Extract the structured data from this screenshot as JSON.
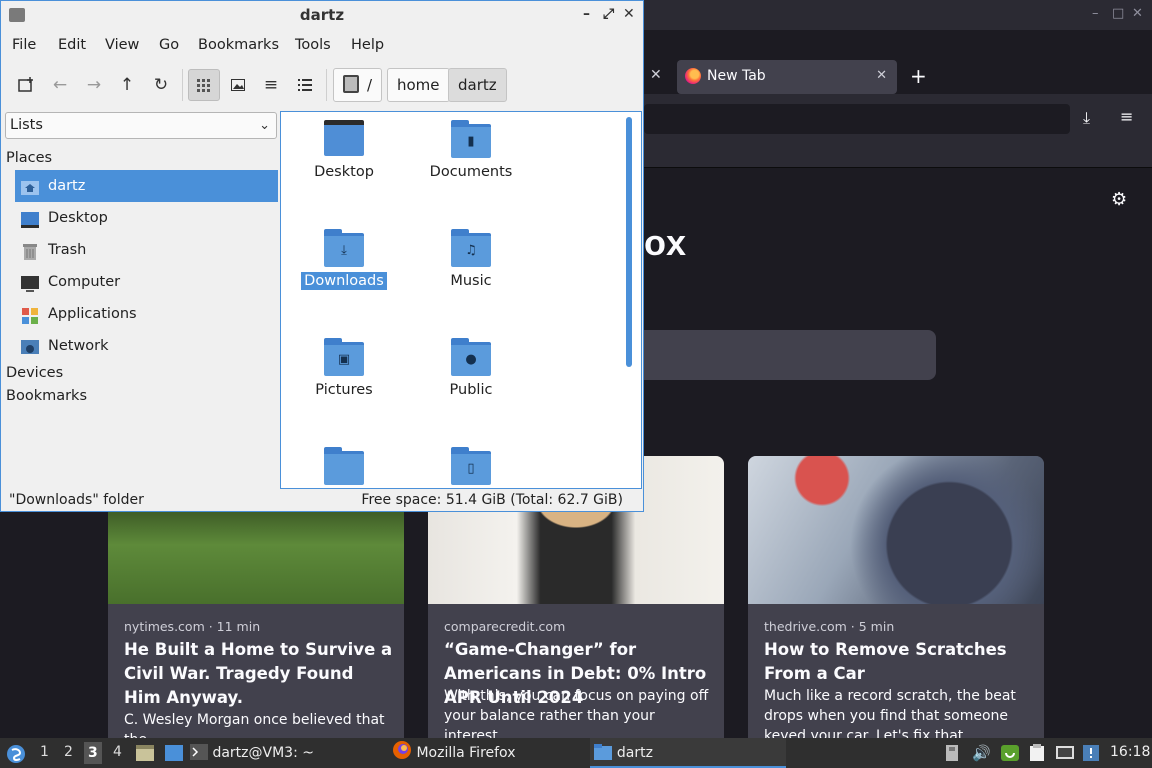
{
  "firefox": {
    "tab_label": "New Tab",
    "tab_close": "✕",
    "prev_tab_close": "✕",
    "new_tab_plus": "+",
    "download_icon": "⤓",
    "menu_icon": "≡",
    "settings_icon": "⚙",
    "wordmark_fragment": "ox",
    "window_controls": [
      "–",
      "□",
      "✕"
    ],
    "stories": [
      {
        "source": "nytimes.com · 11 min",
        "title": "He Built a Home to Survive a Civil War. Tragedy Found Him Anyway.",
        "excerpt": "C. Wesley Morgan once believed that the"
      },
      {
        "source": "comparecredit.com",
        "title": "“Game-Changer” for Americans in Debt: 0% Intro APR Until 2024",
        "excerpt": "With this, you can focus on paying off your balance rather than your interest."
      },
      {
        "source": "thedrive.com · 5 min",
        "title": "How to Remove Scratches From a Car",
        "excerpt": "Much like a record scratch, the beat drops when you find that someone keyed your car. Let's fix that."
      }
    ]
  },
  "filemanager": {
    "title": "dartz",
    "window_buttons": [
      "–",
      "⤢",
      "✕"
    ],
    "menu": [
      "File",
      "Edit",
      "View",
      "Go",
      "Bookmarks",
      "Tools",
      "Help"
    ],
    "path": {
      "root": "/",
      "segments": [
        "home",
        "dartz"
      ]
    },
    "sidebar_mode": "Lists",
    "sidebar": {
      "places_header": "Places",
      "places": [
        "dartz",
        "Desktop",
        "Trash",
        "Computer",
        "Applications",
        "Network"
      ],
      "devices_header": "Devices",
      "bookmarks_header": "Bookmarks"
    },
    "files": [
      "Desktop",
      "Documents",
      "Downloads",
      "Music",
      "Pictures",
      "Public",
      "",
      ""
    ],
    "selected_file": "Downloads",
    "status_left": "\"Downloads\" folder",
    "status_right": "Free space: 51.4 GiB (Total: 62.7 GiB)"
  },
  "taskbar": {
    "workspaces": [
      "1",
      "2",
      "3",
      "4"
    ],
    "current_workspace": "3",
    "tasks": [
      "dartz@VM3: ~",
      "Mozilla Firefox",
      "dartz"
    ],
    "clock": "16:18"
  },
  "colors": {
    "accent": "#4a90d9",
    "firefox_bg": "#1c1b22",
    "firefox_card": "#42414d",
    "taskbar_bg": "#2f2f2f"
  }
}
